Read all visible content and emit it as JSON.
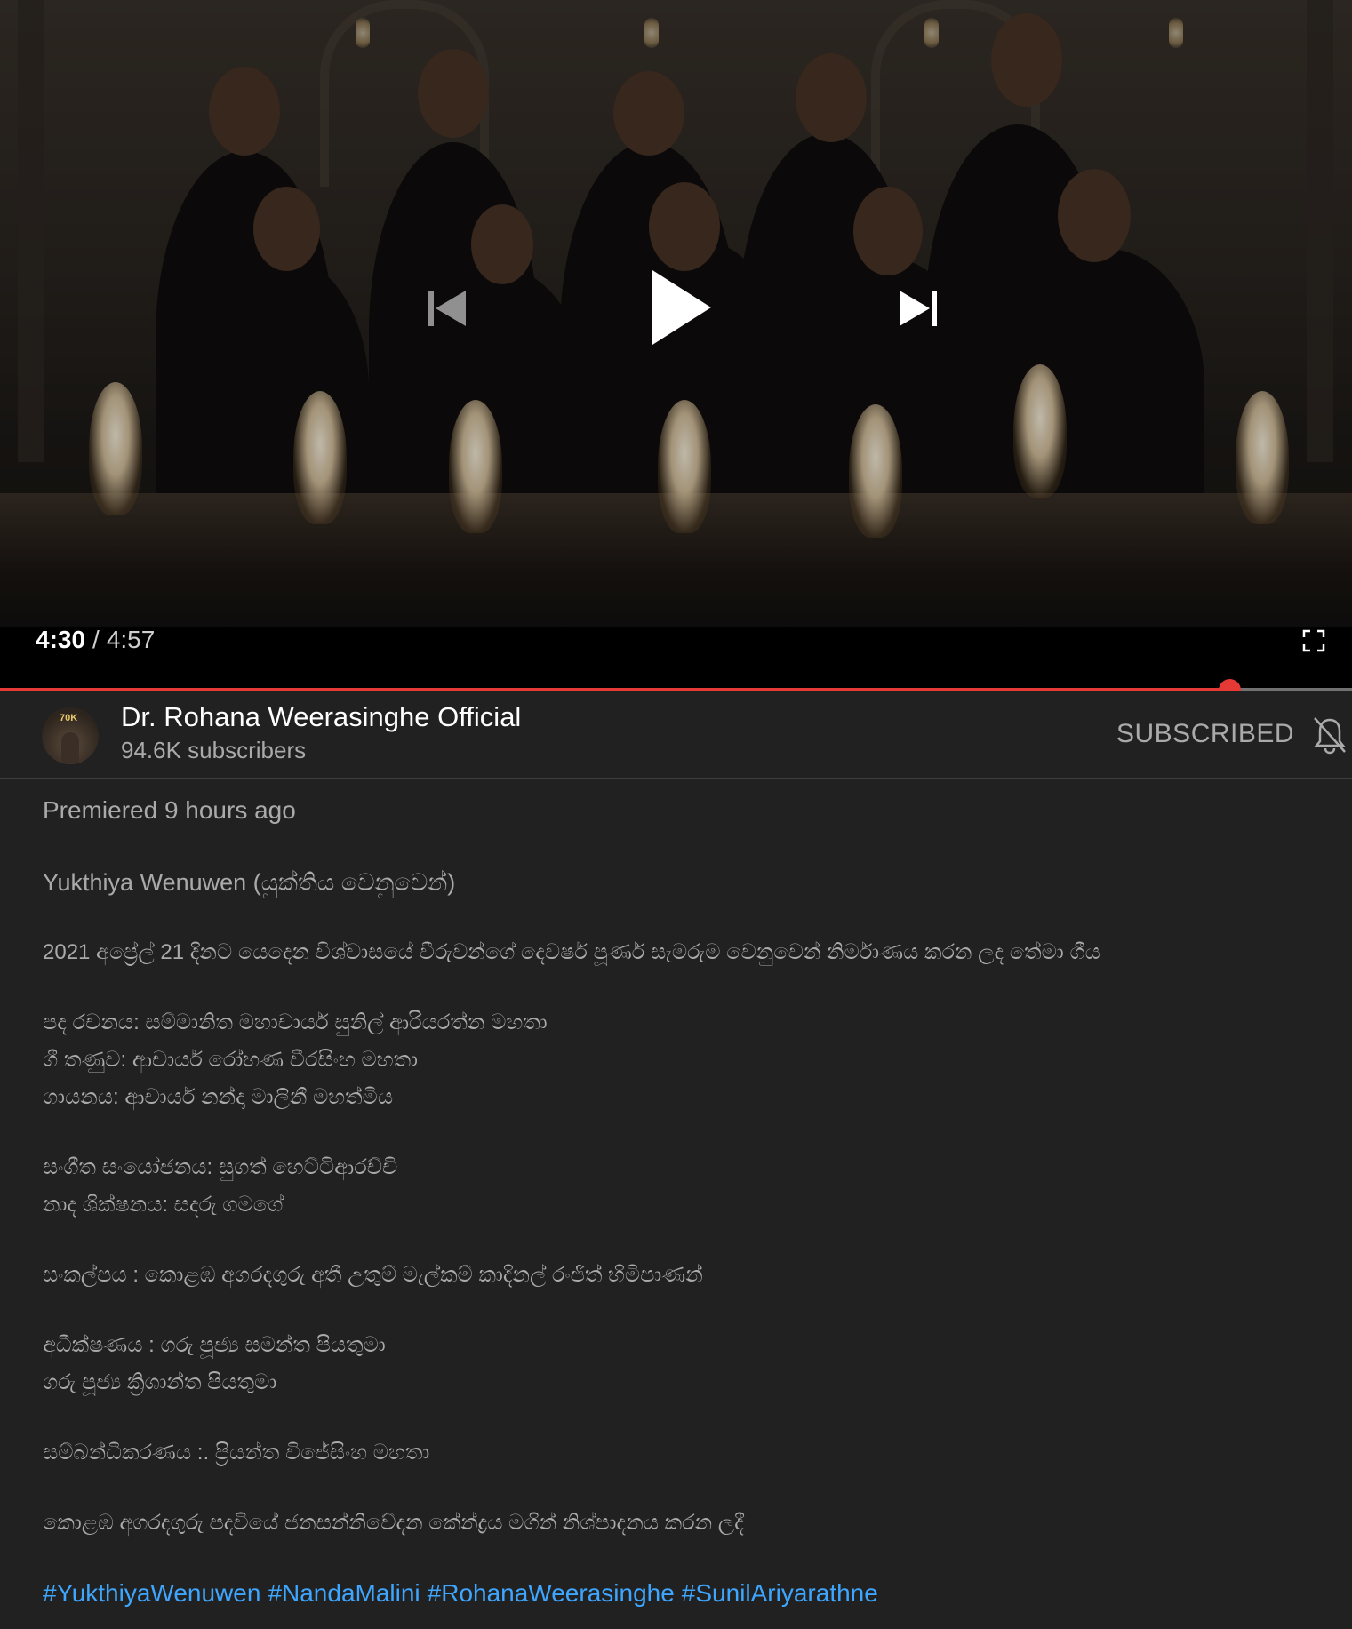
{
  "player": {
    "current_time": "4:30",
    "separator": "/",
    "duration": "4:57",
    "progress_fraction": 0.909,
    "icons": {
      "prev": "skip-previous-icon",
      "play": "play-icon",
      "next": "skip-next-icon",
      "fullscreen": "fullscreen-icon"
    }
  },
  "channel": {
    "avatar_badge": "70K",
    "name": "Dr. Rohana Weerasinghe Official",
    "subscribers": "94.6K subscribers",
    "subscribed_label": "SUBSCRIBED",
    "bell_icon": "notifications-off-icon"
  },
  "description": {
    "premiered": "Premiered 9 hours ago",
    "title": "Yukthiya Wenuwen (යුක්තිය වෙනුවෙන්)",
    "paragraphs": [
      [
        "2021 අප්‍රේල් 21 දිනට යෙදෙන විශ්වාසයේ වීරුවන්ගේ දෙවර්ෂ පූර්ණ සැමරුම වෙනුවෙන් නිර්මාණය කරන ලද තේමා ගීය"
      ],
      [
        "පද රචනය: සම්මානිත මහාචාර්ය සුනිල් ආරියරත්න මහතා",
        "ගී තණුව: ආචාර්ය රෝහණ වීරසිංහ මහතා",
        "ගායනය: ආචාර්ය නන්දා මාලිනී මහත්මිය"
      ],
      [
        "සංගීත සංයෝජනය: සුගත් හෙට්ටිආරච්චි",
        "නාද ශික්ෂනය: සදරු ගමගේ"
      ],
      [
        "සංකල්පය : කොළඹ අගරදගුරු අතී උතුම් මැල්කම් කාදිනල් රංජිත් හිමිපාණන්"
      ],
      [
        "අධීක්ෂණය : ගරු පූජ්‍ය සමන්ත  පියතුමා",
        "ගරු පූජ්‍ය ක්‍රිශාන්ත පියතුමා"
      ],
      [
        "සම්බන්ධීකරණය :.  ප්‍රියන්ත විජේසිංහ මහතා"
      ],
      [
        "කොළඹ අගරදගුරු පදවියේ ජනසන්නිවේදන කේන්ද්‍රය මගින් නිශ්පාදනය කරන ලදී"
      ]
    ],
    "hashtags": [
      "#YukthiyaWenuwen",
      "#NandaMalini",
      "#RohanaWeerasinghe",
      "#SunilAriyarathne"
    ]
  },
  "colors": {
    "background": "#212121",
    "progress": "#e53935",
    "hashtag": "#3ea6ff",
    "secondary_text": "#aaaaaa"
  }
}
